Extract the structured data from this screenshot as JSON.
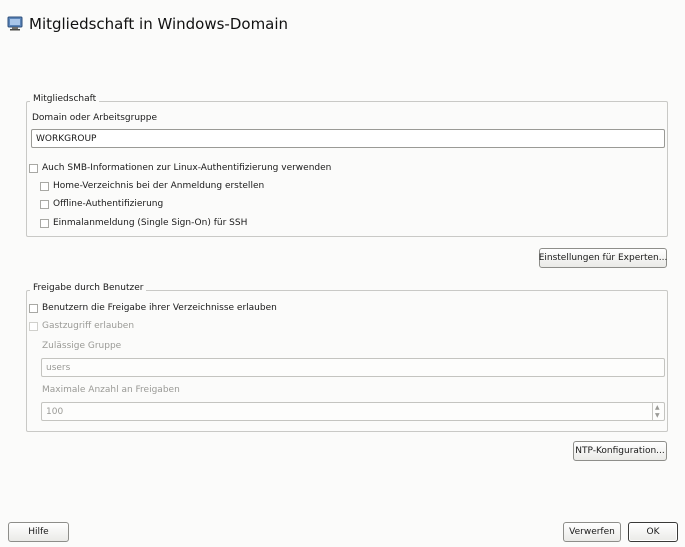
{
  "window": {
    "title": "Mitgliedschaft in Windows-Domain",
    "icon": "network-computer-icon"
  },
  "membership": {
    "legend": "Mitgliedschaft",
    "domain_label": "Domain oder Arbeitsgruppe",
    "domain_value": "WORKGROUP",
    "smb_auth": {
      "label": "Auch SMB-Informationen zur Linux-Authentifizierung verwenden",
      "checked": false
    },
    "home_dir": {
      "label": "Home-Verzeichnis bei der Anmeldung erstellen",
      "checked": false
    },
    "offline_auth": {
      "label": "Offline-Authentifizierung",
      "checked": false
    },
    "sso_ssh": {
      "label": "Einmalanmeldung (Single Sign-On) für SSH",
      "checked": false
    }
  },
  "buttons": {
    "expert_settings": "Einstellungen für Experten...",
    "ntp_config": "NTP-Konfiguration...",
    "help": "Hilfe",
    "discard": "Verwerfen",
    "ok": "OK"
  },
  "sharing": {
    "legend": "Freigabe durch Benutzer",
    "allow_shares": {
      "label": "Benutzern die Freigabe ihrer Verzeichnisse erlauben",
      "checked": false
    },
    "guest_access": {
      "label": "Gastzugriff erlauben",
      "checked": false,
      "disabled": true
    },
    "group_label": "Zulässige Gruppe",
    "group_value": "users",
    "max_shares_label": "Maximale Anzahl an Freigaben",
    "max_shares_value": "100"
  }
}
